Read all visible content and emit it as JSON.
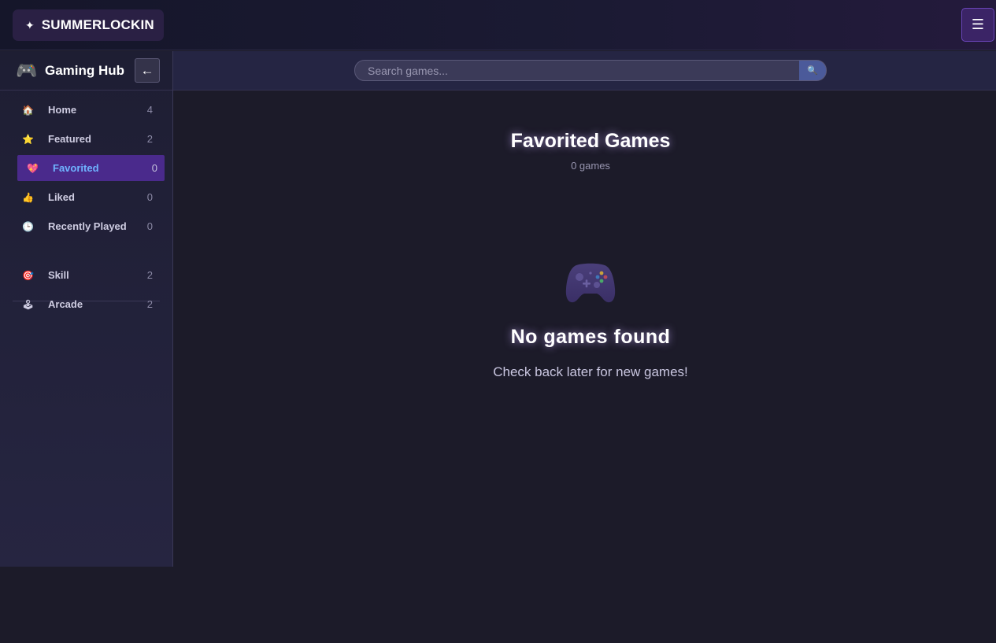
{
  "topbar": {
    "brand_icon": "sparkle-icon",
    "brand_glyph": "✦",
    "brand_text": "SUMMERLOCKIN",
    "menu_glyph": "☰"
  },
  "sidebar": {
    "logo_icon": "gamepad-icon",
    "logo_glyph": "🎮",
    "title": "Gaming Hub",
    "collapse_glyph": "←",
    "items": [
      {
        "icon": "house-icon",
        "glyph": "🏠",
        "label": "Home",
        "count": "4",
        "active": false
      },
      {
        "icon": "star-icon",
        "glyph": "⭐",
        "label": "Featured",
        "count": "2",
        "active": false
      },
      {
        "icon": "heart-icon",
        "glyph": "💖",
        "label": "Favorited",
        "count": "0",
        "active": true
      },
      {
        "icon": "thumbs-up-icon",
        "glyph": "👍",
        "label": "Liked",
        "count": "0",
        "active": false
      },
      {
        "icon": "clock-icon",
        "glyph": "🕒",
        "label": "Recently Played",
        "count": "0",
        "active": false
      },
      {
        "icon": "target-icon",
        "glyph": "🎯",
        "label": "Skill",
        "count": "2",
        "active": false
      },
      {
        "icon": "joystick-icon",
        "glyph": "🕹",
        "label": "Arcade",
        "count": "2",
        "active": false
      }
    ]
  },
  "search": {
    "placeholder": "Search games...",
    "button_icon": "search-icon",
    "button_glyph": "🔍"
  },
  "main": {
    "title": "Favorited Games",
    "subtitle": "0 games",
    "empty_icon": "gamepad-icon",
    "empty_title": "No games found",
    "empty_text": "Check back later for new games!"
  },
  "colors": {
    "accent": "#4a2a8c",
    "active_label": "#6fb3ff",
    "background": "#1c1b29"
  }
}
